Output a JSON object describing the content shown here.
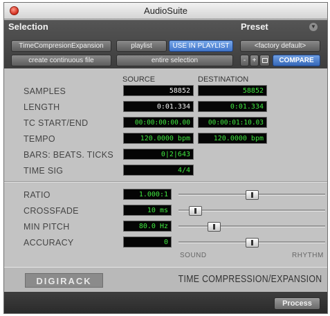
{
  "window": {
    "title": "AudioSuite"
  },
  "selection": {
    "header": "Selection",
    "mode_button": "TimeCompresionExpansion",
    "playlist_button": "playlist",
    "use_in_playlist_button": "USE IN PLAYLIST",
    "file_mode_button": "create continuous file",
    "selection_scope_button": "entire selection"
  },
  "preset": {
    "header": "Preset",
    "name_button": "<factory default>",
    "minus_label": "-",
    "plus_label": "+",
    "compare_button": "COMPARE",
    "menu_icon": "chevron-down-icon",
    "copy_icon": "copy-icon"
  },
  "columns": {
    "source": "SOURCE",
    "destination": "DESTINATION"
  },
  "rows": {
    "samples": {
      "label": "SAMPLES",
      "source": "58852",
      "destination": "58852"
    },
    "length": {
      "label": "LENGTH",
      "source": "0:01.334",
      "destination": "0:01.334"
    },
    "tc": {
      "label": "TC START/END",
      "source": "00:00:00:00.00",
      "destination": "00:00:01:10.03"
    },
    "tempo": {
      "label": "TEMPO",
      "source": "120.0000 bpm",
      "destination": "120.0000 bpm"
    },
    "bars": {
      "label": "BARS: BEATS. TICKS",
      "source": "0|2|643"
    },
    "timesig": {
      "label": "TIME SIG",
      "source": "4/4"
    }
  },
  "params": {
    "ratio": {
      "label": "RATIO",
      "value": "1.000:1",
      "level": 0.5
    },
    "crossfade": {
      "label": "CROSSFADE",
      "value": "10 ms",
      "level": 0.08
    },
    "min_pitch": {
      "label": "MIN PITCH",
      "value": "80.0 Hz",
      "level": 0.22
    },
    "accuracy": {
      "label": "ACCURACY",
      "value": "0",
      "level": 0.5
    }
  },
  "accuracy_scale": {
    "left": "SOUND",
    "right": "RHYTHM"
  },
  "footer": {
    "brand": "DIGIRACK",
    "plugin_name": "TIME COMPRESSION/EXPANSION"
  },
  "bottom": {
    "process_button": "Process"
  },
  "colors": {
    "field_green": "#3fe83f",
    "accent_blue": "#3f74c9"
  }
}
